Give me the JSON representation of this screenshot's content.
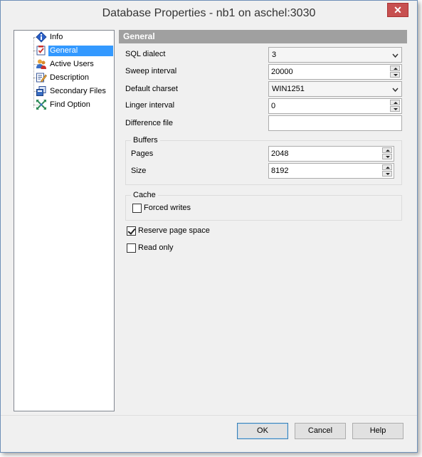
{
  "window": {
    "title": "Database Properties - nb1 on aschel:3030",
    "close_label": "✕"
  },
  "tree": {
    "items": [
      {
        "label": "Info",
        "icon": "info-icon"
      },
      {
        "label": "General",
        "icon": "checklist-icon",
        "selected": true
      },
      {
        "label": "Active Users",
        "icon": "users-icon"
      },
      {
        "label": "Description",
        "icon": "edit-document-icon"
      },
      {
        "label": "Secondary Files",
        "icon": "files-icon"
      },
      {
        "label": "Find Option",
        "icon": "find-option-icon"
      }
    ]
  },
  "general": {
    "header": "General",
    "sql_dialect": {
      "label": "SQL dialect",
      "value": "3"
    },
    "sweep_interval": {
      "label": "Sweep interval",
      "value": "20000"
    },
    "default_charset": {
      "label": "Default charset",
      "value": "WIN1251"
    },
    "linger_interval": {
      "label": "Linger interval",
      "value": "0"
    },
    "difference_file": {
      "label": "Difference file",
      "value": ""
    },
    "buffers": {
      "title": "Buffers",
      "pages": {
        "label": "Pages",
        "value": "2048"
      },
      "size": {
        "label": "Size",
        "value": "8192"
      }
    },
    "cache": {
      "title": "Cache",
      "forced_writes": {
        "label": "Forced writes",
        "checked": false
      }
    },
    "reserve_page_space": {
      "label": "Reserve page space",
      "checked": true
    },
    "read_only": {
      "label": "Read only",
      "checked": false
    }
  },
  "buttons": {
    "ok": "OK",
    "cancel": "Cancel",
    "help": "Help"
  }
}
